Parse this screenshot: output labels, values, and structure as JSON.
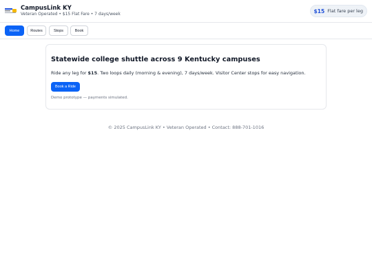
{
  "header": {
    "logo_alt": "CampusLink KY logo",
    "title": "CampusLink KY",
    "subtitle": "Veteran Operated • $15 Flat Fare • 7 days/week",
    "fare_pill": {
      "amount": "$15",
      "label": "Flat fare per leg"
    }
  },
  "nav": {
    "items": [
      {
        "label": "Home",
        "active": true
      },
      {
        "label": "Routes",
        "active": false
      },
      {
        "label": "Stops",
        "active": false
      },
      {
        "label": "Book",
        "active": false
      }
    ]
  },
  "hero": {
    "title": "Statewide college shuttle across 9 Kentucky campuses",
    "body_prefix": "Ride any leg for ",
    "body_price": "$15",
    "body_suffix": ". Two loops daily (morning & evening), 7 days/week. Visitor Center stops for easy navigation.",
    "cta_label": "Book a Ride",
    "note": "Demo prototype — payments simulated."
  },
  "footer": {
    "text": "© 2025 CampusLink KY • Veteran Operated • Contact: 888-701-1016"
  },
  "colors": {
    "accent": "#0b63f6",
    "fare_amount": "#1d4ed8",
    "pill_bg": "#eef2f7",
    "border": "#e5e7eb"
  }
}
